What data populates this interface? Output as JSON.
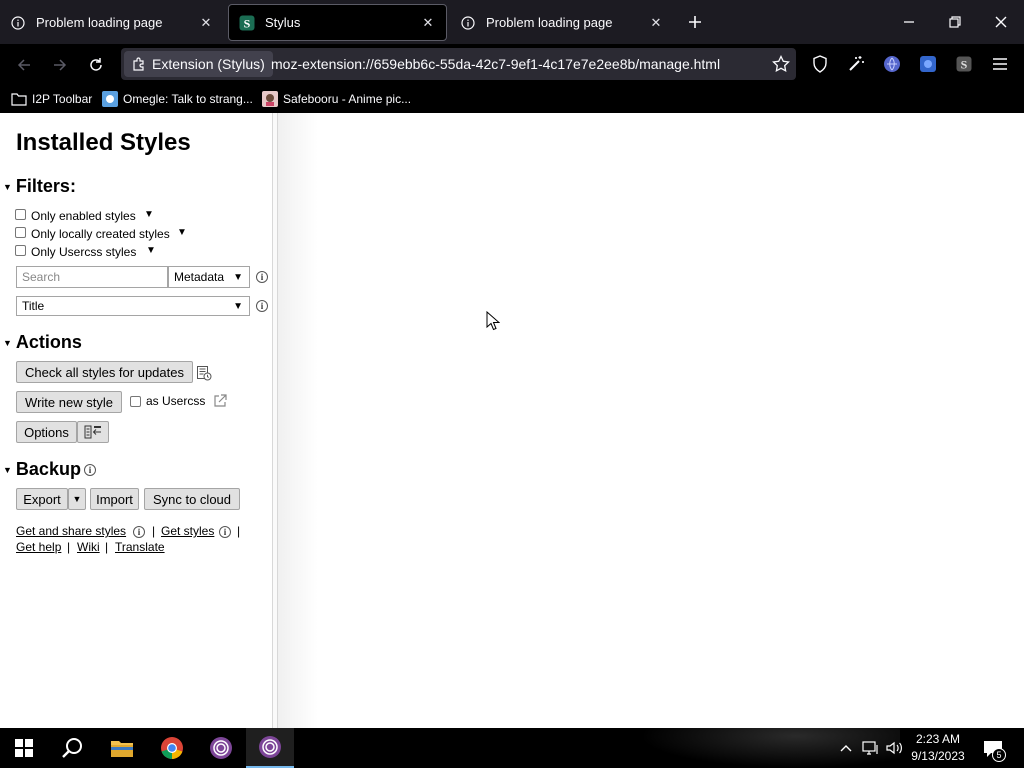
{
  "browser": {
    "tabs": [
      {
        "label": "Problem loading page",
        "icon": "info-icon",
        "active": false
      },
      {
        "label": "Stylus",
        "icon": "stylus-icon",
        "active": true
      },
      {
        "label": "Problem loading page",
        "icon": "info-icon",
        "active": false
      }
    ],
    "identity_label": "Extension (Stylus)",
    "url": "moz-extension://659ebb6c-55da-42c7-9ef1-4c17e7e2ee8b/manage.html",
    "bookmarks": [
      {
        "label": "I2P Toolbar",
        "icon": "folder-icon"
      },
      {
        "label": "Omegle: Talk to strang...",
        "icon": "omegle-icon"
      },
      {
        "label": "Safebooru - Anime pic...",
        "icon": "safebooru-icon"
      }
    ]
  },
  "manager": {
    "title": "Installed Styles",
    "filters": {
      "heading": "Filters:",
      "enabled_label": "Only enabled styles",
      "local_label": "Only locally created styles",
      "usercss_label": "Only Usercss styles",
      "search_placeholder": "Search",
      "search_mode": "Metadata",
      "sort_value": "Title"
    },
    "actions": {
      "heading": "Actions",
      "check_updates": "Check all styles for updates",
      "write_new": "Write new style",
      "as_usercss": "as Usercss",
      "options": "Options"
    },
    "backup": {
      "heading": "Backup",
      "export": "Export",
      "import": "Import",
      "sync": "Sync to cloud"
    },
    "links": {
      "get_and_share": "Get and share styles",
      "get_styles": "Get styles",
      "get_help": "Get help",
      "wiki": "Wiki",
      "translate": "Translate",
      "separator": "|"
    }
  },
  "taskbar": {
    "time": "2:23 AM",
    "date": "9/13/2023",
    "notification_count": "5"
  },
  "colors": {
    "browser_bg": "#000000",
    "urlbar_bg": "#2b2a33",
    "button_bg": "#e1e1e1"
  }
}
